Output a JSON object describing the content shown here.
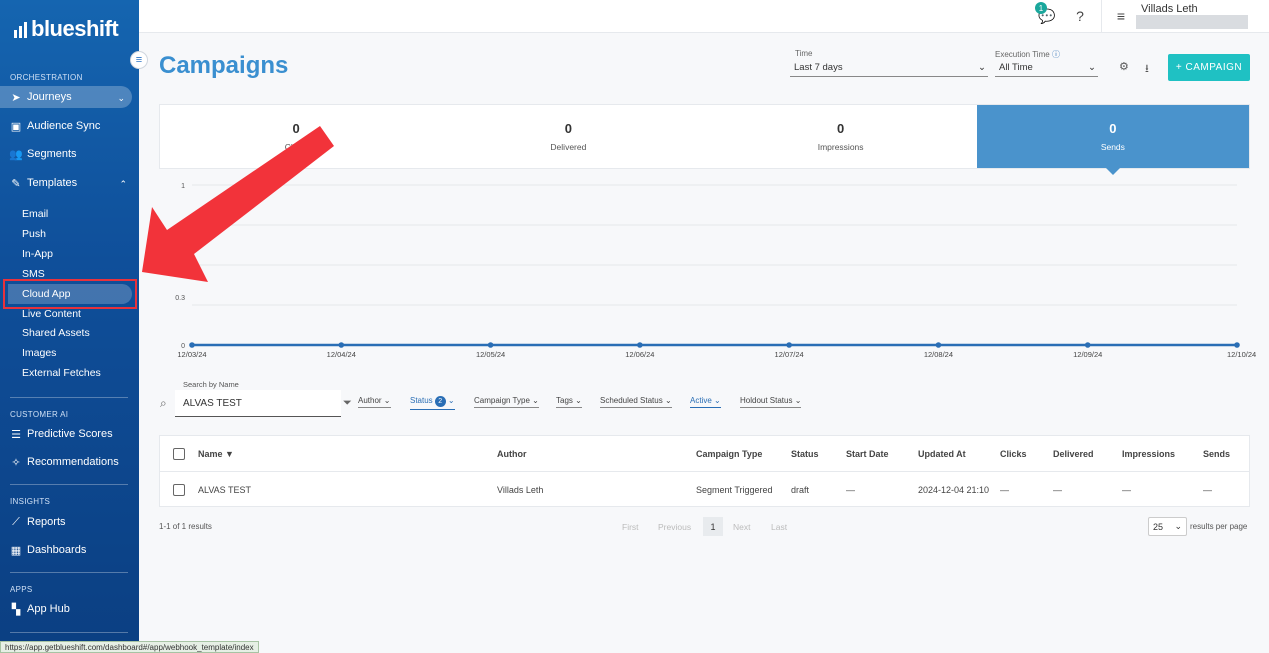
{
  "brand": {
    "name": "blueshift"
  },
  "sidebar": {
    "sections": {
      "orchestration": "ORCHESTRATION",
      "customer_ai": "CUSTOMER AI",
      "insights": "INSIGHTS",
      "apps": "APPS"
    },
    "items": {
      "journeys": "Journeys",
      "audience_sync": "Audience Sync",
      "segments": "Segments",
      "templates": "Templates",
      "predictive_scores": "Predictive Scores",
      "recommendations": "Recommendations",
      "reports": "Reports",
      "dashboards": "Dashboards",
      "app_hub": "App Hub"
    },
    "template_sub": [
      "Email",
      "Push",
      "In-App",
      "SMS",
      "Cloud App",
      "Live Content",
      "Shared Assets",
      "Images",
      "External Fetches"
    ]
  },
  "topbar": {
    "notification_count": "1",
    "user_name": "Villads Leth"
  },
  "header": {
    "title": "Campaigns",
    "time_label": "Time",
    "time_value": "Last 7 days",
    "exec_label": "Execution Time",
    "exec_value": "All Time",
    "campaign_button": "+ CAMPAIGN"
  },
  "stats": [
    {
      "value": "0",
      "label": "Clicks"
    },
    {
      "value": "0",
      "label": "Delivered"
    },
    {
      "value": "0",
      "label": "Impressions"
    },
    {
      "value": "0",
      "label": "Sends"
    }
  ],
  "chart_data": {
    "type": "line",
    "x": [
      "12/03/24",
      "12/04/24",
      "12/05/24",
      "12/06/24",
      "12/07/24",
      "12/08/24",
      "12/09/24",
      "12/10/24"
    ],
    "series": [
      {
        "values": [
          0,
          0,
          0,
          0,
          0,
          0,
          0,
          0
        ]
      }
    ],
    "y_ticks": [
      "1",
      "0.3",
      "0"
    ],
    "ylim": [
      0,
      1
    ],
    "grid": true,
    "color": "#2a6eb5"
  },
  "filters": {
    "search_label": "Search by Name",
    "search_value": "ALVAS TEST",
    "author": "Author",
    "status": "Status",
    "status_count": "2",
    "campaign_type": "Campaign Type",
    "tags": "Tags",
    "scheduled_status": "Scheduled Status",
    "active": "Active",
    "holdout_status": "Holdout Status"
  },
  "table": {
    "headers": [
      "Name ▼",
      "Author",
      "Campaign Type",
      "Status",
      "Start Date",
      "Updated At",
      "Clicks",
      "Delivered",
      "Impressions",
      "Sends"
    ],
    "rows": [
      [
        "ALVAS TEST",
        "Villads Leth",
        "Segment Triggered",
        "draft",
        "—",
        "2024-12-04 21:10",
        "—",
        "—",
        "—",
        "—"
      ]
    ]
  },
  "pagination": {
    "results": "1-1 of 1 results",
    "first": "First",
    "previous": "Previous",
    "current": "1",
    "next": "Next",
    "last": "Last",
    "per_page": "25",
    "per_page_label": "results per page"
  },
  "status_url": "https://app.getblueshift.com/dashboard#/app/webhook_template/index"
}
